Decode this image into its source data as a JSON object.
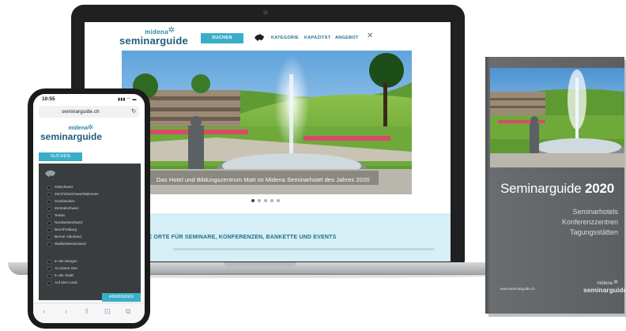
{
  "laptop": {
    "logo": {
      "brand_small": "midena",
      "brand_main": "seminarguide"
    },
    "search_button": "SUCHEN",
    "nav": {
      "kategorie": "KATEGORIE",
      "kapazitaet": "KAPAZITÄT",
      "angebot": "ANGEBOT"
    },
    "hero_caption": "Das Hotel und Bildungszentrum Matt ist Midena Seminarhotel des Jahres 2020",
    "carousel_total": 5,
    "carousel_active": 1,
    "band_title": "ENDE ORTE FÜR SEMINARE, KONFERENZEN, BANKETTE UND EVENTS"
  },
  "phone": {
    "time": "10:55",
    "signal": "▮▮▮ ◠ ▬",
    "url": "seminarguide.ch",
    "logo": {
      "brand_small": "midena",
      "brand_main": "seminarguide"
    },
    "search_button": "SUCHEN",
    "regions": [
      "Ostschweiz",
      "Zürich/Zürichsee/Walensee",
      "Graubünden",
      "Zentralschweiz",
      "Tessin",
      "Nordwestschweiz",
      "Bern/Freiburg",
      "Berner Oberland",
      "Wallis/Westschweiz"
    ],
    "locations": [
      "In den Bergen",
      "An einem See",
      "In der Stadt",
      "Auf dem Land"
    ],
    "apply_button": "ANWENDEN",
    "toolbar": [
      "‹",
      "›",
      "⇪",
      "⊡",
      "⧉"
    ]
  },
  "book": {
    "title_word": "Seminarguide",
    "title_year": "2020",
    "subtitles": [
      "Seminarhotels",
      "Konferenzzentren",
      "Tagungsstätten"
    ],
    "url": "www.seminarguide.ch",
    "logo": {
      "brand_small": "midena",
      "brand_main": "seminarguide"
    }
  },
  "colors": {
    "accent": "#3aaec9",
    "brand": "#1e5d7c",
    "band": "#d6eef5",
    "book": "#5c5f62"
  }
}
